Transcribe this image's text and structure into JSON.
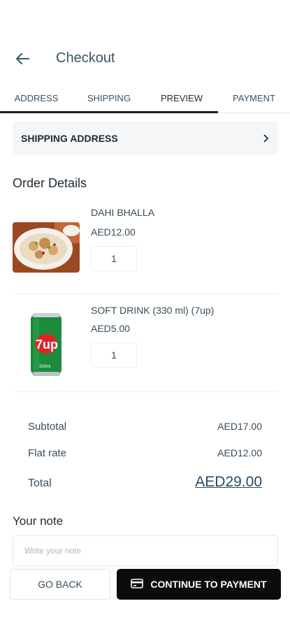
{
  "header": {
    "title": "Checkout"
  },
  "tabs": [
    {
      "label": "ADDRESS"
    },
    {
      "label": "SHIPPING"
    },
    {
      "label": "PREVIEW"
    },
    {
      "label": "PAYMENT"
    }
  ],
  "shipping_address": {
    "label": "SHIPPING ADDRESS"
  },
  "order": {
    "title": "Order Details",
    "items": [
      {
        "name": "DAHI BHALLA",
        "price": "AED12.00",
        "qty": "1"
      },
      {
        "name": "SOFT DRINK (330 ml) (7up)",
        "price": "AED5.00",
        "qty": "1"
      }
    ]
  },
  "totals": {
    "subtotal_label": "Subtotal",
    "subtotal_value": "AED17.00",
    "flat_label": "Flat rate",
    "flat_value": "AED12.00",
    "total_label": "Total",
    "total_value": "AED29.00"
  },
  "note": {
    "title": "Your note",
    "placeholder": "Write your note"
  },
  "actions": {
    "back_label": "GO BACK",
    "continue_label": "CONTINUE TO PAYMENT"
  },
  "product_image_text": {
    "can_logo": "7up",
    "can_small": "330ml"
  }
}
